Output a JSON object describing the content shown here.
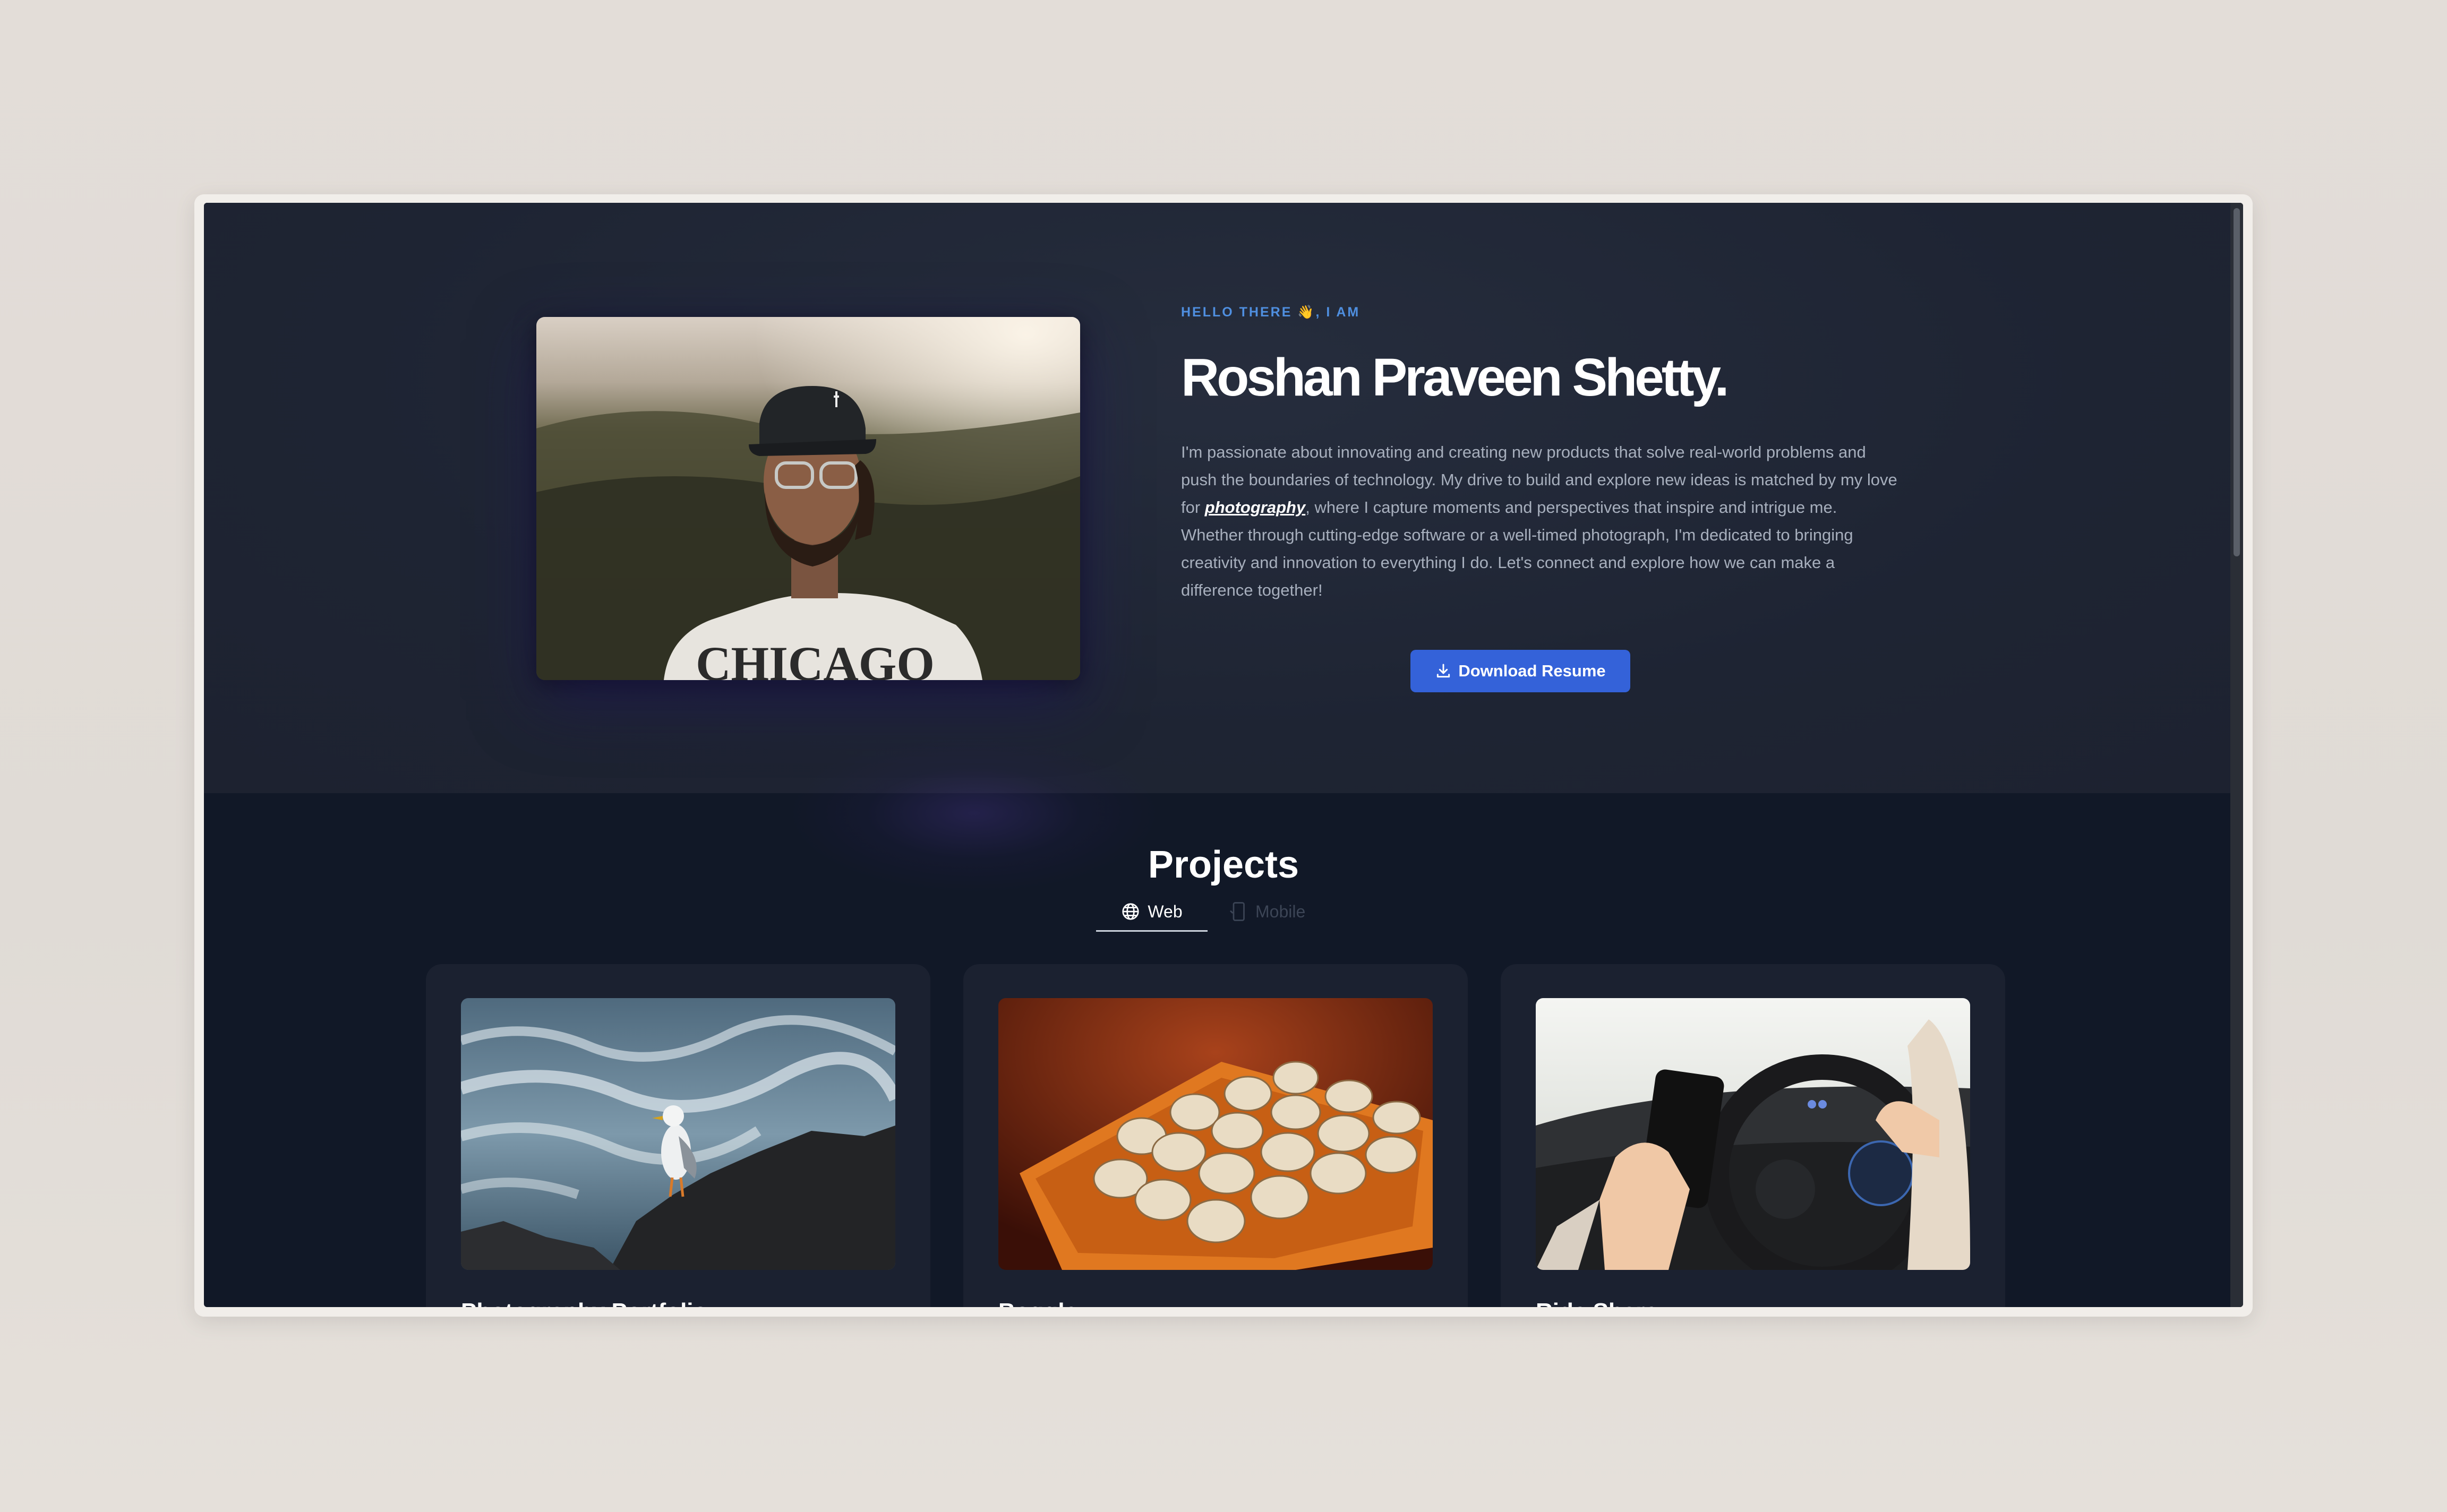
{
  "hero": {
    "eyebrow": "HELLO THERE 👋, I AM",
    "name": "Roshan Praveen Shetty.",
    "bio_before": "I'm passionate about innovating and creating new products that solve real-world problems and push the boundaries of technology. My drive to build and explore new ideas is matched by my love for ",
    "bio_link": "photography",
    "bio_after": ", where I capture moments and perspectives that inspire and intrigue me. Whether through cutting-edge software or a well-timed photograph, I'm dedicated to bringing creativity and innovation to everything I do. Let's connect and explore how we can make a difference together!",
    "download_label": "Download Resume",
    "photo_shirt_text": "CHICAGO"
  },
  "projects": {
    "title": "Projects",
    "tabs": [
      {
        "label": "Web",
        "icon": "globe-icon",
        "active": true
      },
      {
        "label": "Mobile",
        "icon": "mobile-icon",
        "active": false
      }
    ],
    "cards": [
      {
        "title": "Photography Portfolio",
        "image": "seagull-on-rock"
      },
      {
        "title": "Boggle",
        "image": "letter-dice-tray"
      },
      {
        "title": "Ride Share",
        "image": "phone-while-driving"
      }
    ]
  },
  "colors": {
    "hero_bg": "#1e2433",
    "page_bg": "#111827",
    "accent": "#3462d9",
    "eyebrow": "#4f8fe0"
  }
}
